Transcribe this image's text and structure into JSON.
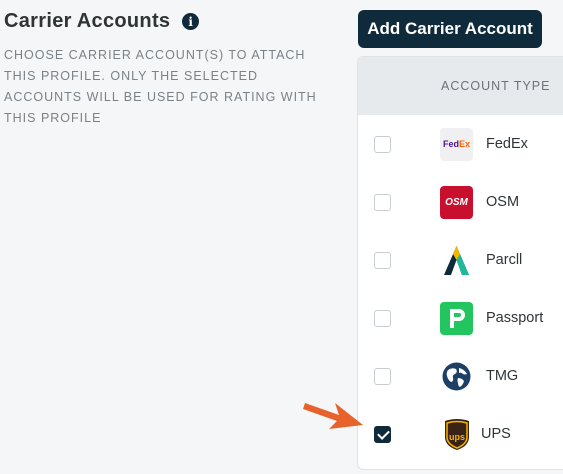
{
  "section": {
    "title": "Carrier Accounts",
    "description": "CHOOSE CARRIER ACCOUNT(S) TO ATTACH THIS PROFILE. ONLY THE SELECTED ACCOUNTS WILL BE USED FOR RATING WITH THIS PROFILE"
  },
  "toolbar": {
    "add_label": "Add Carrier Account"
  },
  "table": {
    "column_header": "ACCOUNT TYPE",
    "rows": [
      {
        "name": "FedEx",
        "checked": false,
        "logo_text_a": "Fed",
        "logo_text_b": "Ex"
      },
      {
        "name": "OSM",
        "checked": false,
        "logo_text": "OSM"
      },
      {
        "name": "Parcll",
        "checked": false
      },
      {
        "name": "Passport",
        "checked": false
      },
      {
        "name": "TMG",
        "checked": false
      },
      {
        "name": "UPS",
        "checked": true,
        "logo_text": "ups"
      }
    ]
  },
  "colors": {
    "brand_dark": "#0f2a3a",
    "arrow": "#e8622c"
  }
}
